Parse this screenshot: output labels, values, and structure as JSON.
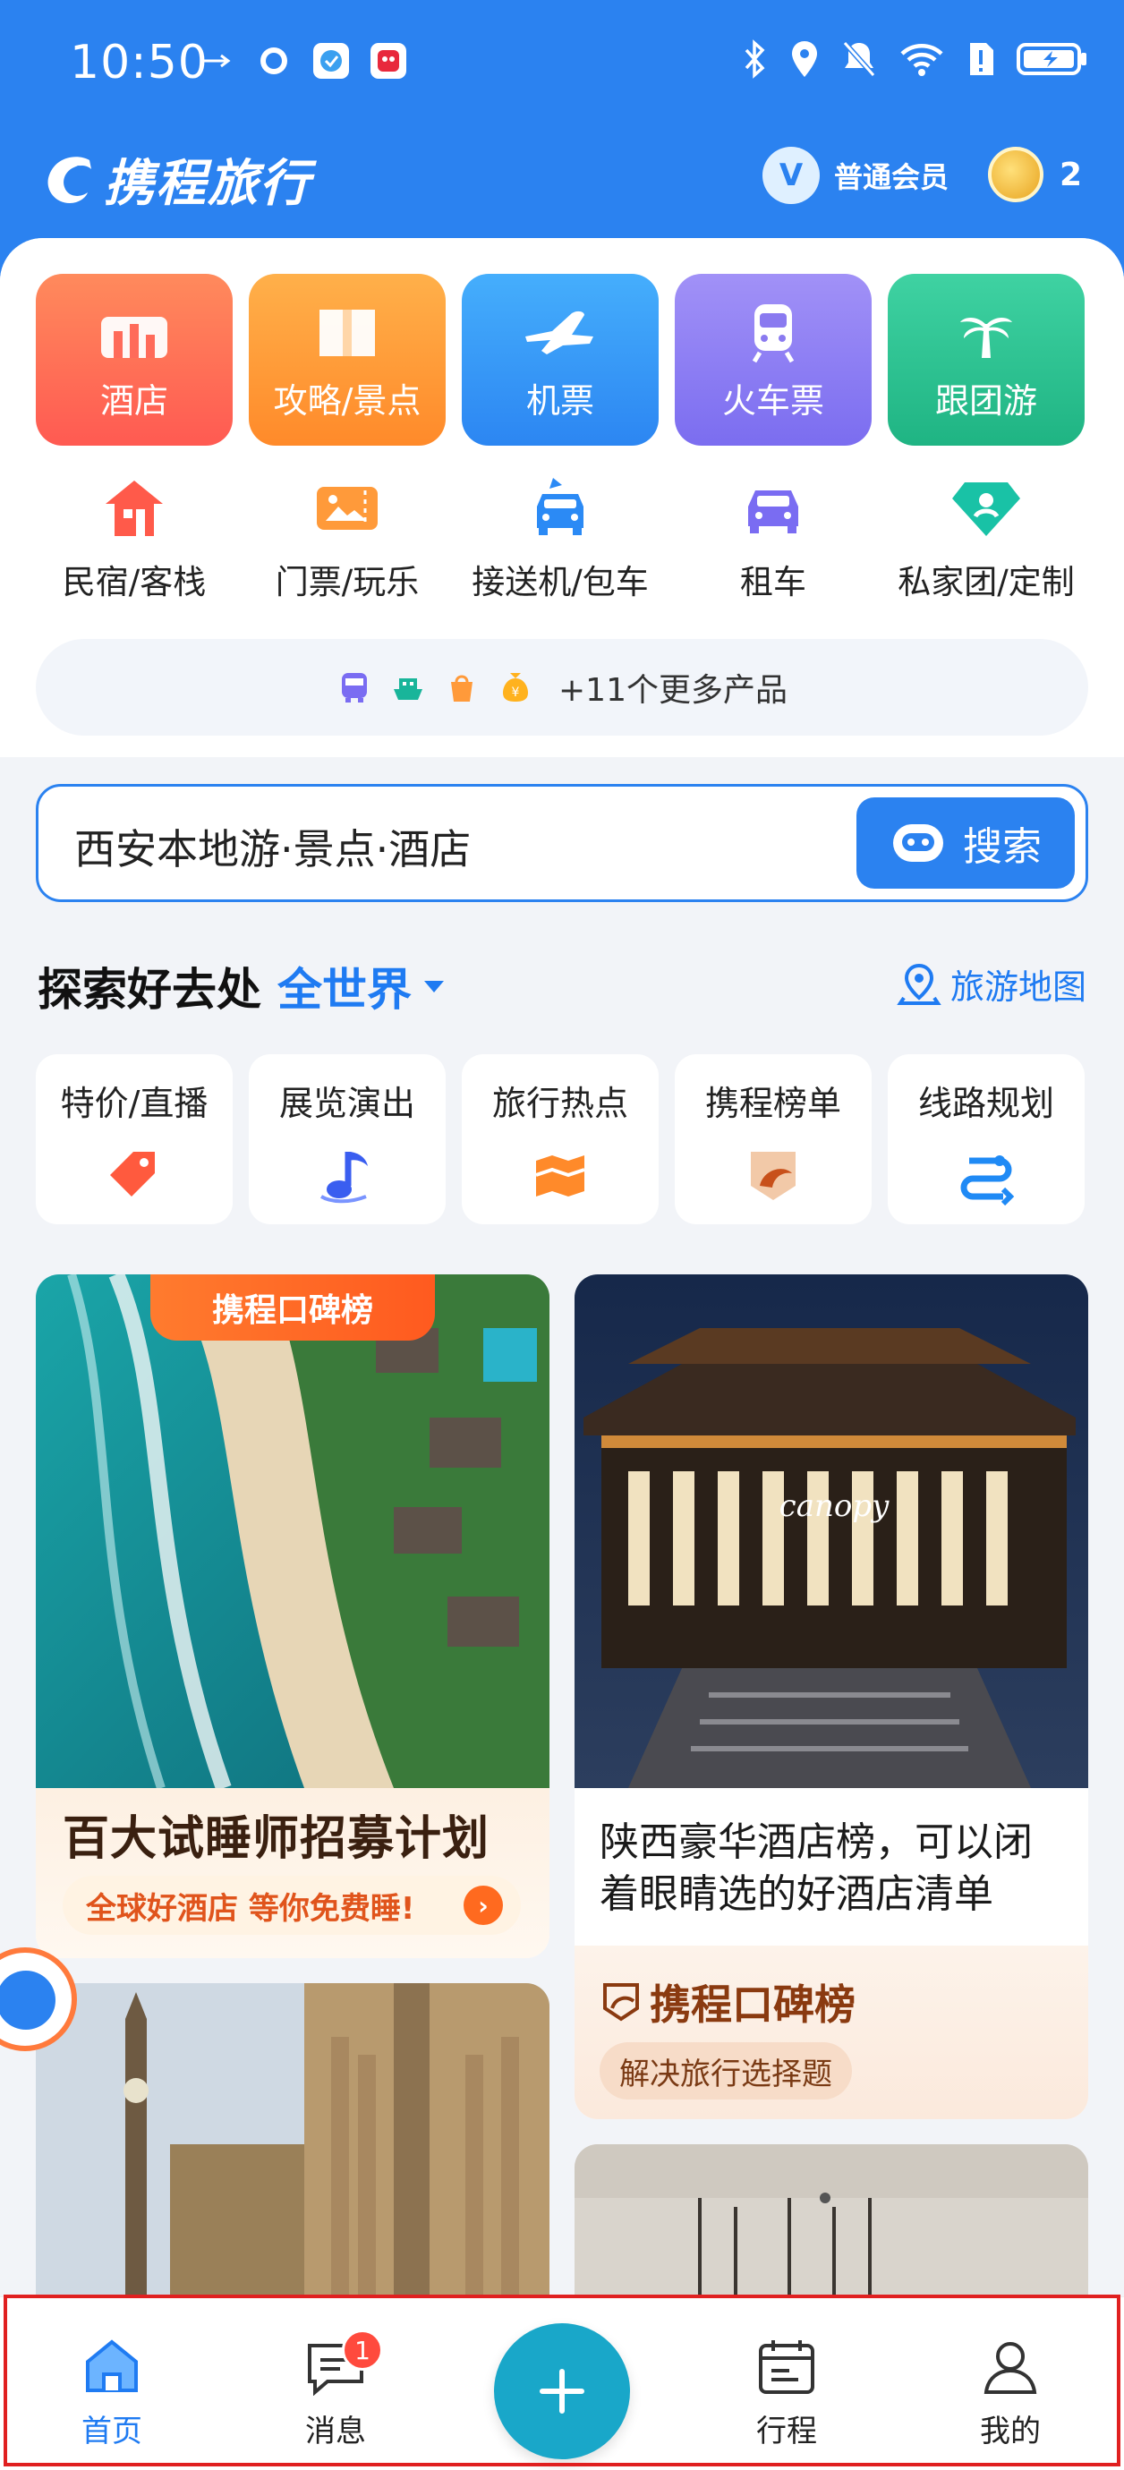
{
  "status_bar": {
    "time": "10:50"
  },
  "header": {
    "brand": "携程旅行",
    "member_badge": "V",
    "member_label": "普通会员",
    "coin_count": "2"
  },
  "big_tiles": [
    {
      "label": "酒店",
      "icon": "hotel-icon",
      "color": "#ff6b5a"
    },
    {
      "label": "攻略/景点",
      "icon": "guide-book-icon",
      "color": "#ff9a3a"
    },
    {
      "label": "机票",
      "icon": "airplane-icon",
      "color": "#3a9cf5"
    },
    {
      "label": "火车票",
      "icon": "train-icon",
      "color": "#8a7af0"
    },
    {
      "label": "跟团游",
      "icon": "palm-tree-icon",
      "color": "#2fc08f"
    }
  ],
  "small_tiles": [
    {
      "label": "民宿/客栈",
      "icon": "house-icon"
    },
    {
      "label": "门票/玩乐",
      "icon": "ticket-icon"
    },
    {
      "label": "接送机/包车",
      "icon": "airport-car-icon"
    },
    {
      "label": "租车",
      "icon": "car-icon"
    },
    {
      "label": "私家团/定制",
      "icon": "diamond-icon"
    }
  ],
  "more_bar": {
    "label": "+11个更多产品"
  },
  "search": {
    "placeholder": "西安本地游·景点·酒店",
    "button": "搜索"
  },
  "explore": {
    "title": "探索好去处",
    "scope": "全世界",
    "map_link": "旅游地图"
  },
  "categories": [
    {
      "label": "特价/直播",
      "icon": "price-tag-icon"
    },
    {
      "label": "展览演出",
      "icon": "music-note-icon"
    },
    {
      "label": "旅行热点",
      "icon": "flame-map-icon"
    },
    {
      "label": "携程榜单",
      "icon": "ranking-icon"
    },
    {
      "label": "线路规划",
      "icon": "route-icon"
    }
  ],
  "cards": {
    "card_a": {
      "rank_pill": "携程口碑榜",
      "title": "百大试睡师招募计划",
      "subtitle": "全球好酒店 等你免费睡!"
    },
    "card_b": {
      "title": "陕西豪华酒店榜，可以闭着眼睛选的好酒店清单",
      "rank_label": "携程口碑榜",
      "tag": "解决旅行选择题",
      "image_text": "canopy"
    }
  },
  "tabbar": {
    "home": "首页",
    "messages": "消息",
    "messages_badge": "1",
    "trips": "行程",
    "mine": "我的"
  }
}
